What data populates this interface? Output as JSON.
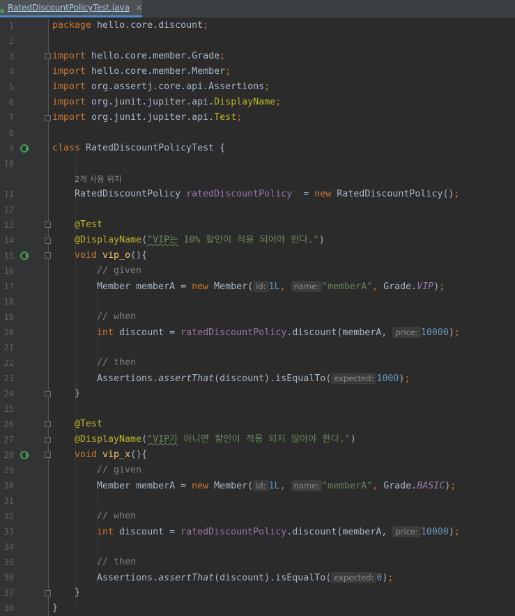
{
  "tab": {
    "filename": "RatedDiscountPolicyTest.java",
    "close": "✕"
  },
  "usage_hint": "2개 사용 위치",
  "line_numbers": [
    "1",
    "2",
    "3",
    "4",
    "5",
    "6",
    "7",
    "8",
    "9",
    "10",
    "11",
    "12",
    "13",
    "14",
    "15",
    "16",
    "17",
    "18",
    "19",
    "20",
    "21",
    "22",
    "23",
    "24",
    "25",
    "26",
    "27",
    "28",
    "29",
    "30",
    "31",
    "32",
    "33",
    "34",
    "35",
    "36",
    "37",
    "38"
  ],
  "code": {
    "package_kw": "package",
    "package_name": " hello.core.discount",
    "semicolon": ";",
    "import_kw": "import",
    "imports": [
      " hello.core.member.Grade",
      " hello.core.member.Member",
      " org.assertj.core.api.Assertions",
      " org.junit.jupiter.api.",
      " org.junit.jupiter.api."
    ],
    "import_highlight": [
      "DisplayName",
      "Test"
    ],
    "class_kw": "class",
    "class_name": " RatedDiscountPolicyTest {",
    "field_type": "RatedDiscountPolicy ",
    "field_name": "ratedDiscountPolicy",
    "assign": "  = ",
    "new_kw": "new",
    "ctor": " RatedDiscountPolicy()",
    "test_ann": "@Test",
    "displayname_ann": "@DisplayName",
    "open_paren": "(",
    "close_paren": ")",
    "display_1_typo": "\"VIP는",
    "display_1_rest": " 10% 할인이 적용 되어야 한다.\"",
    "display_2_typo": "\"VIP가",
    "display_2_rest": " 아니면 할인이 적용 되지 않아야 한다.\"",
    "void_kw": "void",
    "method_1": "vip_o",
    "method_2": "vip_x",
    "method_tail": "(){",
    "comment_given": "// given",
    "comment_when": "// when",
    "comment_then": "// then",
    "member_decl": "Member memberA = ",
    "member_ctor": " Member(",
    "hint_id": "id:",
    "id_value": "1L",
    "comma": ", ",
    "hint_name": "name:",
    "name_value": "\"memberA\"",
    "grade_prefix": "Grade.",
    "grade_vip": "VIP",
    "grade_basic": "BASIC",
    "int_kw": "int",
    "discount_decl": " discount = ",
    "discount_field": "ratedDiscountPolicy",
    "discount_call": ".discount(memberA, ",
    "hint_price": "price:",
    "price_value": "10000",
    "assertions": "Assertions.",
    "assert_that": "assertThat",
    "assert_mid": "(discount).isEqualTo(",
    "hint_expected": "expected:",
    "expected_1": "1000",
    "expected_2": "0",
    "close_brace": "}"
  }
}
